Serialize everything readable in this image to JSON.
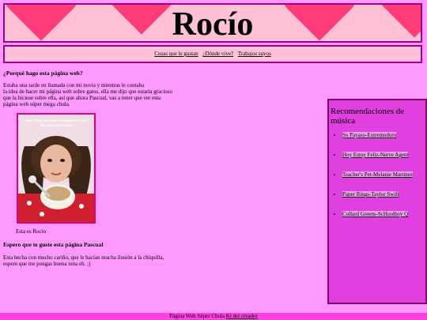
{
  "header": {
    "title": "Rocío"
  },
  "nav": {
    "links": [
      "Cosas que le gustan",
      "¿Dónde vive?",
      "Trabajos suyos"
    ]
  },
  "main": {
    "heading1": "¿Porqué hago esta página web?",
    "para1_lines": [
      "Estaba una tarde en llamada con mi novia y mientras le contaba",
      "la idea de hacer mi página web sobre gatos, ella me dijo que estaría gracioso",
      "que la hiciese sobre ella, así que ahora Pascual, vas a tener que ver esta",
      "página web súper mega chula."
    ],
    "photo_text": "una chica loca con su capuccino en una taza d corazón",
    "caption": "Esta es Rocío",
    "heading2": "Espero que te guste esta página Pascual",
    "para2_lines": [
      "Esta hecha con mucho cariño, que le hacían mucha ilusión a la chiquilla,",
      "espero que me pongas buena nota eh. ;)"
    ]
  },
  "sidebar": {
    "title": "Recomendaciones de música",
    "items": [
      "So Payaso-Extremoduro",
      "Hoy Estoy Feliz-Nerve Agent",
      "Teacher's Pet-Melanie Martinez",
      "Paper Rings-Taylor Swift",
      "Collard Greens-ScHoolboy Q"
    ]
  },
  "footer": {
    "text": "Página Web Súper Chula",
    "link": "Ki del creador"
  }
}
